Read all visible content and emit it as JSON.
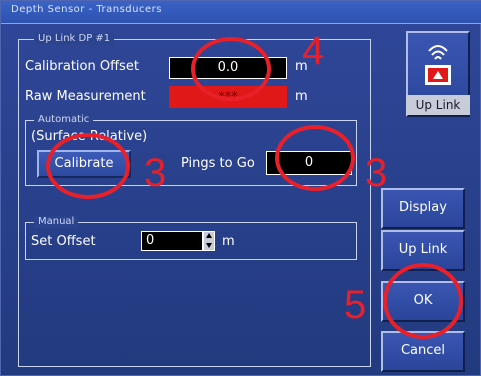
{
  "window": {
    "title": "Depth Sensor - Transducers"
  },
  "uplink_panel": {
    "legend": "Up Link DP #1",
    "calibration_offset": {
      "label": "Calibration Offset",
      "value": "0.0",
      "unit": "m"
    },
    "raw_measurement": {
      "label": "Raw Measurement",
      "value": "***",
      "unit": "m"
    },
    "automatic": {
      "legend": "Automatic",
      "mode": "(Surface Relative)",
      "calibrate_label": "Calibrate",
      "pings_label": "Pings to Go",
      "pings_value": "0"
    },
    "manual": {
      "legend": "Manual",
      "set_offset_label": "Set Offset",
      "set_offset_value": "0",
      "unit": "m"
    }
  },
  "sidebar": {
    "uplink_icon_label": "Up Link",
    "display_label": "Display",
    "uplink_label": "Up Link",
    "ok_label": "OK",
    "cancel_label": "Cancel"
  },
  "annotations": {
    "n4": "4",
    "n3a": "3",
    "n3b": "3",
    "n5": "5",
    "color": "#e8202a"
  },
  "colors": {
    "background": "#2a3e82",
    "raw_measurement_field": "#e01818",
    "value_field": "#000000"
  }
}
